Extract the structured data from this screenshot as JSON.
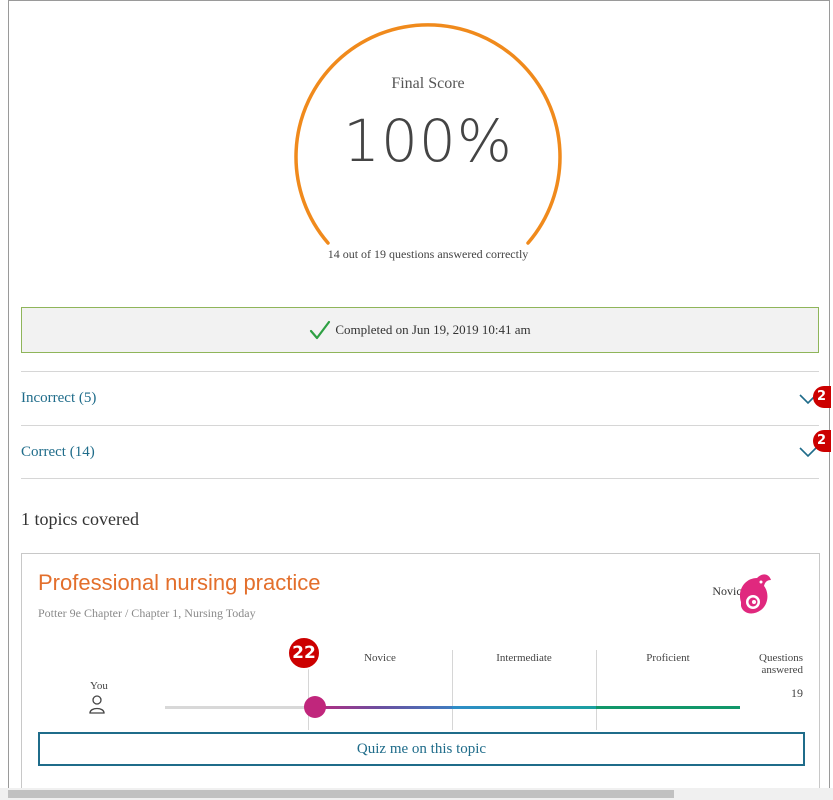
{
  "score": {
    "title": "Final Score",
    "value": "100%",
    "subtitle": "14 out of 19 questions answered correctly",
    "accent_color": "#f08a1c"
  },
  "completion": {
    "icon": "checkmark-icon",
    "text": "Completed on Jun 19, 2019 10:41 am",
    "icon_color": "#2ea043"
  },
  "accordions": [
    {
      "label": "Incorrect (5)",
      "icon": "chevron-down-icon",
      "badge": "2"
    },
    {
      "label": "Correct (14)",
      "icon": "chevron-down-icon",
      "badge": "2"
    }
  ],
  "topics": {
    "heading": "1 topics covered",
    "items": [
      {
        "title": "Professional nursing practice",
        "subtitle": "Potter 9e Chapter / Chapter 1, Nursing Today",
        "level": "Novice",
        "level_icon": "chameleon-icon",
        "scale_labels": [
          "Novice",
          "Intermediate",
          "Proficient"
        ],
        "you_label": "You",
        "questions_label": "Questions answered",
        "questions_value": "19",
        "progress_fraction": 0.26,
        "badge": "22",
        "button_label": "Quiz me on this topic"
      }
    ]
  },
  "colors": {
    "link": "#1f6c8a",
    "title_orange": "#e36f2c",
    "thumb": "#c0267c",
    "border_green": "#8fb55a"
  }
}
